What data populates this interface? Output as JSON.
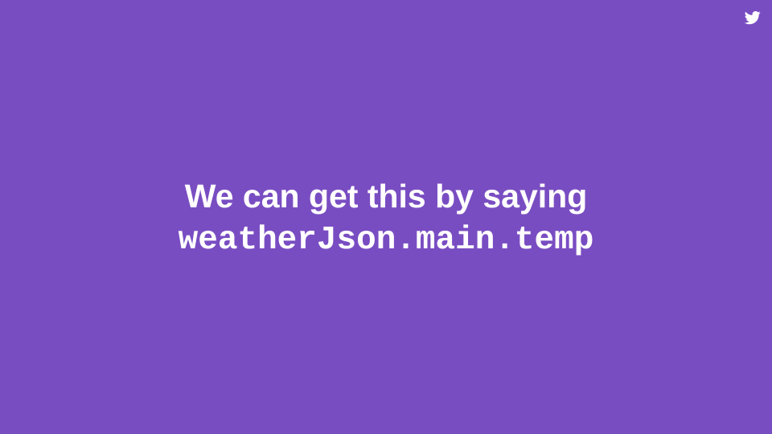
{
  "slide": {
    "background_color": "#794dc2",
    "text_color": "#ffffff",
    "headline": "We can get this by saying",
    "code": "weatherJson.main.temp",
    "corner_icon": "twitter-bird-icon"
  }
}
